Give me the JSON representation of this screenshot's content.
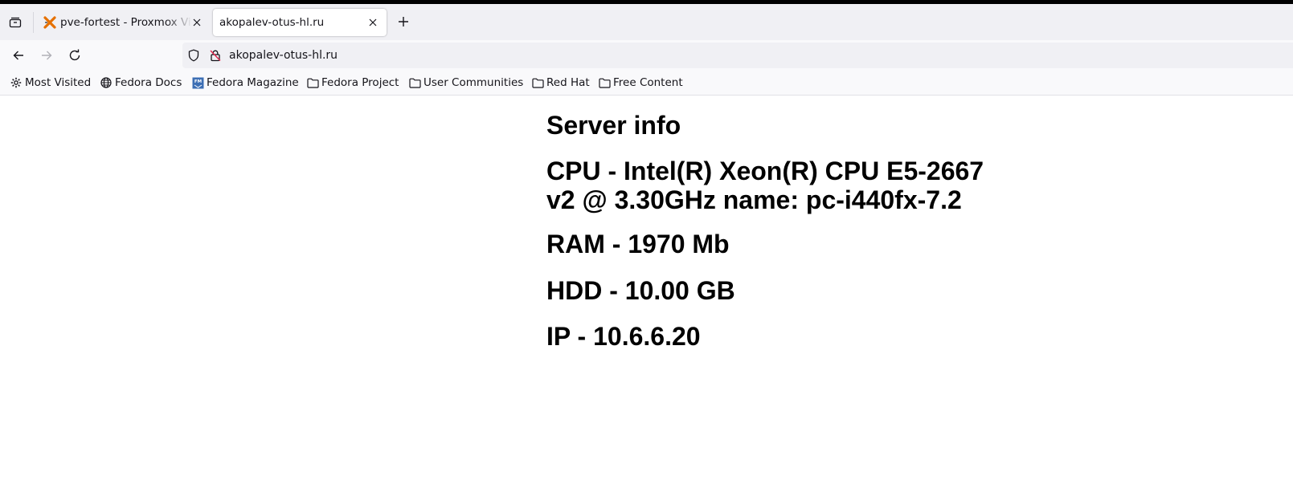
{
  "browser": {
    "tabs": [
      {
        "title": "pve-fortest - Proxmox Virtual Environment",
        "favicon": "proxmox-icon",
        "active": false
      },
      {
        "title": "akopalev-otus-hl.ru",
        "active": true
      }
    ],
    "url": "akopalev-otus-hl.ru",
    "bookmarks": [
      {
        "label": "Most Visited",
        "icon": "gear-icon"
      },
      {
        "label": "Fedora Docs",
        "icon": "globe-icon"
      },
      {
        "label": "Fedora Magazine",
        "icon": "fedora-magazine-icon"
      },
      {
        "label": "Fedora Project",
        "icon": "folder-icon"
      },
      {
        "label": "User Communities",
        "icon": "folder-icon"
      },
      {
        "label": "Red Hat",
        "icon": "folder-icon"
      },
      {
        "label": "Free Content",
        "icon": "folder-icon"
      }
    ]
  },
  "page": {
    "heading": "Server info",
    "cpu": "CPU - Intel(R) Xeon(R) CPU E5-2667 v2 @ 3.30GHz name: pc-i440fx-7.2",
    "ram": "RAM - 1970 Mb",
    "hdd": "HDD - 10.00 GB",
    "ip": "IP - 10.6.6.20"
  },
  "colors": {
    "proxmox_orange": "#e57000",
    "insecure_red": "#e22850",
    "magazine_blue": "#3c6eb4"
  }
}
